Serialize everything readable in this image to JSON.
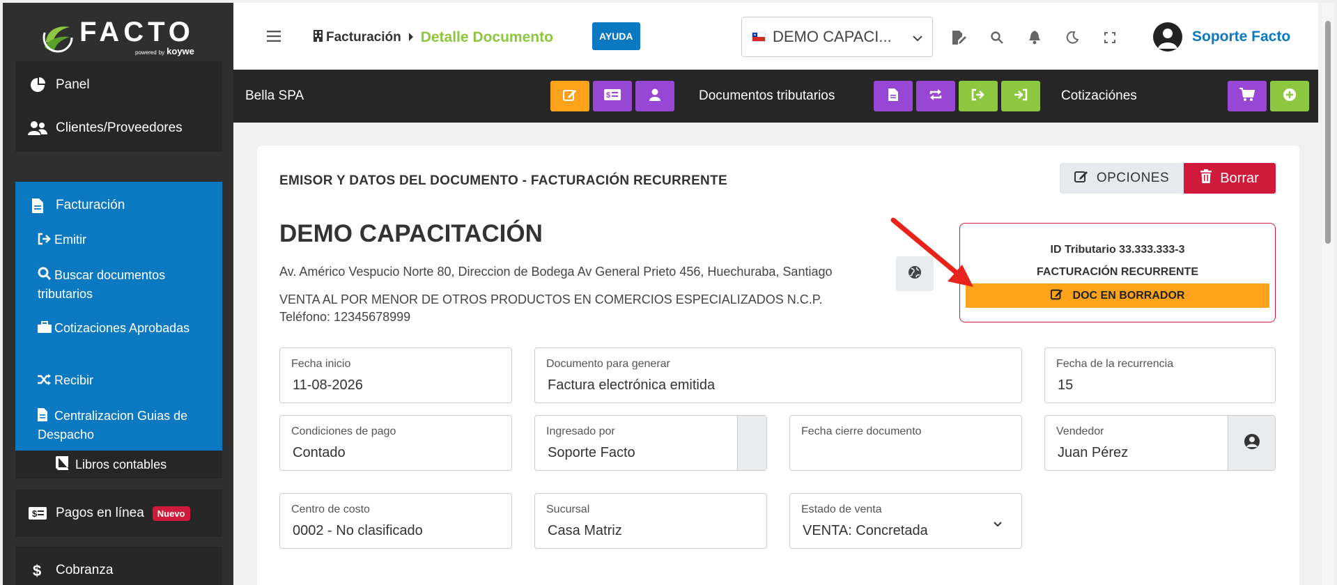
{
  "brand": {
    "name": "FACTO",
    "powered": "powered",
    "by": "by",
    "partner": "koywe"
  },
  "sidebar": {
    "items": [
      {
        "label": "Panel",
        "icon": "pie-chart-icon"
      },
      {
        "label": "Clientes/Proveedores",
        "icon": "users-icon"
      },
      {
        "label": "Facturación",
        "icon": "file-icon"
      },
      {
        "label": "Libros contables",
        "icon": "book-icon"
      },
      {
        "label": "Pagos en línea",
        "icon": "money-bill-icon",
        "badge": "Nuevo"
      },
      {
        "label": "Cobranza",
        "icon": "dollar-icon"
      }
    ],
    "subitems": [
      {
        "label": "Emitir",
        "icon": "sign-out-icon"
      },
      {
        "label": "Buscar documentos tributarios",
        "icon": "search-icon"
      },
      {
        "label": "Cotizaciones Aprobadas",
        "icon": "briefcase-icon"
      },
      {
        "label": "Recibir",
        "icon": "shuffle-icon"
      },
      {
        "label": "Centralizacion Guias de Despacho",
        "icon": "file-icon"
      }
    ]
  },
  "header": {
    "breadcrumb_root": "Facturación",
    "breadcrumb_current": "Detalle Documento",
    "help": "AYUDA",
    "company": "DEMO CAPACI...",
    "user": "Soporte Facto"
  },
  "secbar": {
    "client": "Bella SPA",
    "docs_label": "Documentos tributarios",
    "quotes_label": "Cotizaciónes"
  },
  "document": {
    "section_title": "EMISOR Y DATOS DEL DOCUMENTO - FACTURACIÓN RECURRENTE",
    "options_label": "OPCIONES",
    "delete_label": "Borrar",
    "emisor_name": "DEMO CAPACITACIÓN",
    "address": "Av. Américo Vespucio Norte 80, Direccion de Bodega Av General Prieto 456, Huechuraba, Santiago",
    "giro": "VENTA AL POR MENOR DE OTROS PRODUCTOS EN COMERCIOS ESPECIALIZADOS N.C.P.",
    "phone": "Teléfono: 12345678999",
    "tax_id": "ID Tributario 33.333.333-3",
    "doc_kind": "FACTURACIÓN RECURRENTE",
    "status": "DOC EN BORRADOR"
  },
  "fields": {
    "fecha_inicio": {
      "label": "Fecha inicio",
      "value": "11-08-2026"
    },
    "documento": {
      "label": "Documento para generar",
      "value": "Factura electrónica emitida"
    },
    "recurrencia": {
      "label": "Fecha de la recurrencia",
      "value": "15"
    },
    "condiciones": {
      "label": "Condiciones de pago",
      "value": "Contado"
    },
    "ingresado": {
      "label": "Ingresado por",
      "value": "Soporte Facto"
    },
    "cierre": {
      "label": "Fecha cierre documento",
      "value": ""
    },
    "vendedor": {
      "label": "Vendedor",
      "value": "Juan Pérez"
    },
    "centro": {
      "label": "Centro de costo",
      "value": "0002 - No clasificado"
    },
    "sucursal": {
      "label": "Sucursal",
      "value": "Casa Matriz"
    },
    "estado": {
      "label": "Estado de venta",
      "value": "VENTA: Concretada"
    }
  },
  "colors": {
    "primary": "#0b78c2",
    "green": "#8dc63f",
    "orange": "#ffa31a",
    "purple": "#9747d3",
    "red": "#d01a3c",
    "dark": "#262626"
  }
}
